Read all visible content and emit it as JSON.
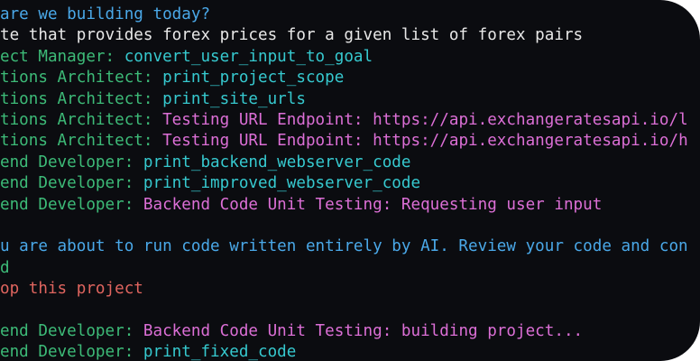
{
  "colors": {
    "background": "#0b0c10",
    "blue": "#4aa8e8",
    "white": "#e8e8e8",
    "cyan": "#36c9cf",
    "green": "#3dbb78",
    "magenta": "#dc6fd6",
    "red": "#e0655f"
  },
  "terminal": {
    "lines": [
      {
        "segments": [
          {
            "text": "are we building today?",
            "color": "blue"
          }
        ]
      },
      {
        "segments": [
          {
            "text": "te that provides forex prices for a given list of forex pairs",
            "color": "white"
          }
        ]
      },
      {
        "segments": [
          {
            "text": "ect Manager: ",
            "color": "green"
          },
          {
            "text": "convert_user_input_to_goal",
            "color": "cyan"
          }
        ]
      },
      {
        "segments": [
          {
            "text": "tions Architect: ",
            "color": "green"
          },
          {
            "text": "print_project_scope",
            "color": "cyan"
          }
        ]
      },
      {
        "segments": [
          {
            "text": "tions Architect: ",
            "color": "green"
          },
          {
            "text": "print_site_urls",
            "color": "cyan"
          }
        ]
      },
      {
        "segments": [
          {
            "text": "tions Architect: ",
            "color": "green"
          },
          {
            "text": "Testing URL Endpoint: https://api.exchangeratesapi.io/l",
            "color": "magenta"
          }
        ]
      },
      {
        "segments": [
          {
            "text": "tions Architect: ",
            "color": "green"
          },
          {
            "text": "Testing URL Endpoint: https://api.exchangeratesapi.io/h",
            "color": "magenta"
          }
        ]
      },
      {
        "segments": [
          {
            "text": "end Developer: ",
            "color": "green"
          },
          {
            "text": "print_backend_webserver_code",
            "color": "cyan"
          }
        ]
      },
      {
        "segments": [
          {
            "text": "end Developer: ",
            "color": "green"
          },
          {
            "text": "print_improved_webserver_code",
            "color": "cyan"
          }
        ]
      },
      {
        "segments": [
          {
            "text": "end Developer: ",
            "color": "green"
          },
          {
            "text": "Backend Code Unit Testing: Requesting user input",
            "color": "magenta"
          }
        ]
      },
      {
        "segments": []
      },
      {
        "segments": [
          {
            "text": "u are about to run code written entirely by AI. Review your code and con",
            "color": "blue"
          }
        ]
      },
      {
        "segments": [
          {
            "text": "d",
            "color": "green"
          }
        ]
      },
      {
        "segments": [
          {
            "text": "op this project",
            "color": "red"
          }
        ]
      },
      {
        "segments": []
      },
      {
        "segments": [
          {
            "text": "end Developer: ",
            "color": "green"
          },
          {
            "text": "Backend Code Unit Testing: building project...",
            "color": "magenta"
          }
        ]
      },
      {
        "segments": [
          {
            "text": "end Developer: ",
            "color": "green"
          },
          {
            "text": "print_fixed_code",
            "color": "cyan"
          }
        ]
      }
    ]
  }
}
